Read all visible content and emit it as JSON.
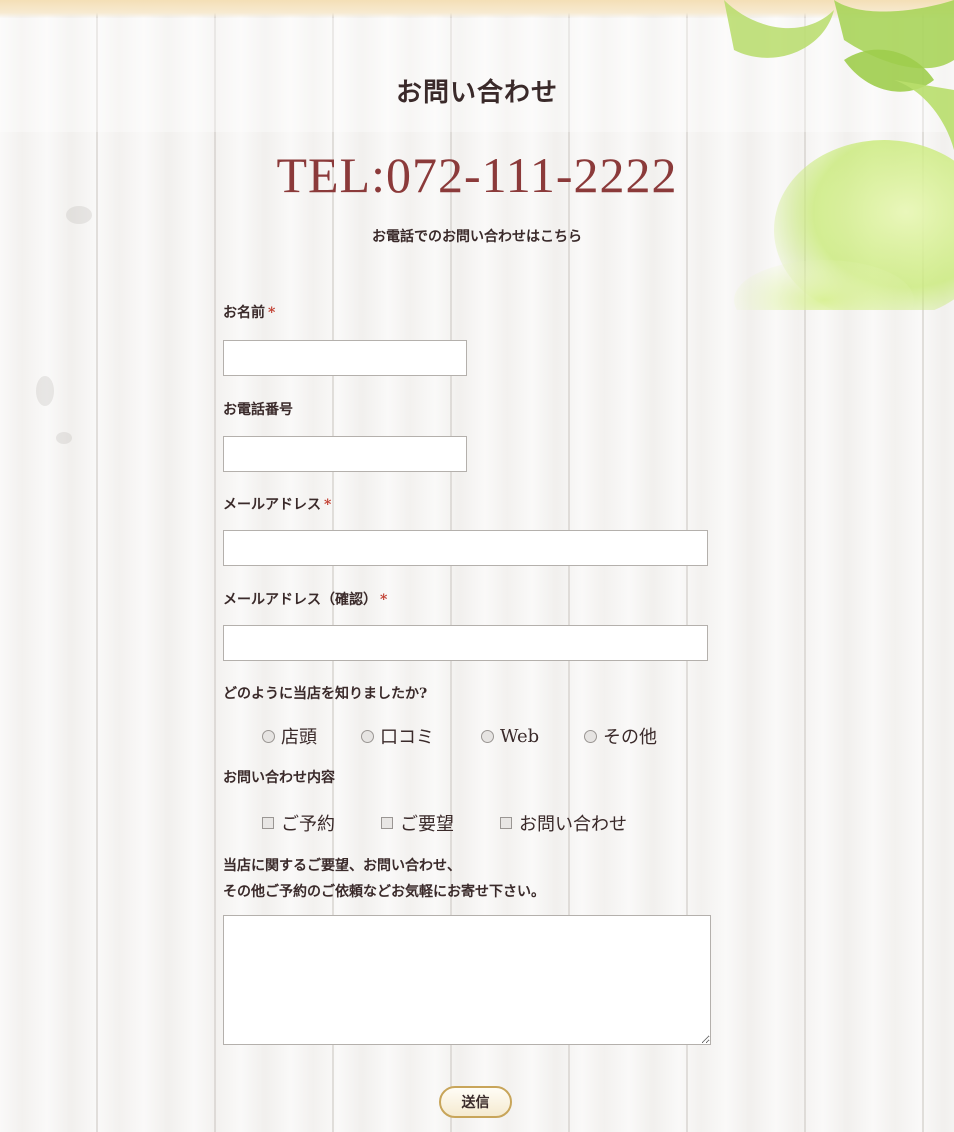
{
  "page": {
    "heading": "お問い合わせ",
    "tel": "TEL:072-111-2222",
    "tel_note": "お電話でのお問い合わせはこちら"
  },
  "form": {
    "required_mark": "*",
    "name_label": "お名前",
    "phone_label": "お電話番号",
    "email_label": "メールアドレス",
    "email_confirm_label": "メールアドレス（確認）",
    "how_label": "どのように当店を知りましたか?",
    "how_options": [
      "店頭",
      "口コミ",
      "Web",
      "その他"
    ],
    "inquiry_label": "お問い合わせ内容",
    "inquiry_options": [
      "ご予約",
      "ご要望",
      "お問い合わせ"
    ],
    "message_note_line1": "当店に関するご要望、お問い合わせ、",
    "message_note_line2": "その他ご予約のご依頼などお気軽にお寄せ下さい。",
    "submit_label": "送信"
  },
  "colors": {
    "accent": "#8b3a3a",
    "required": "#c0392b",
    "button_border": "#c8a55a",
    "top_band": "#f4dfb6"
  },
  "icons": {
    "decoration": "leaf-icon"
  }
}
